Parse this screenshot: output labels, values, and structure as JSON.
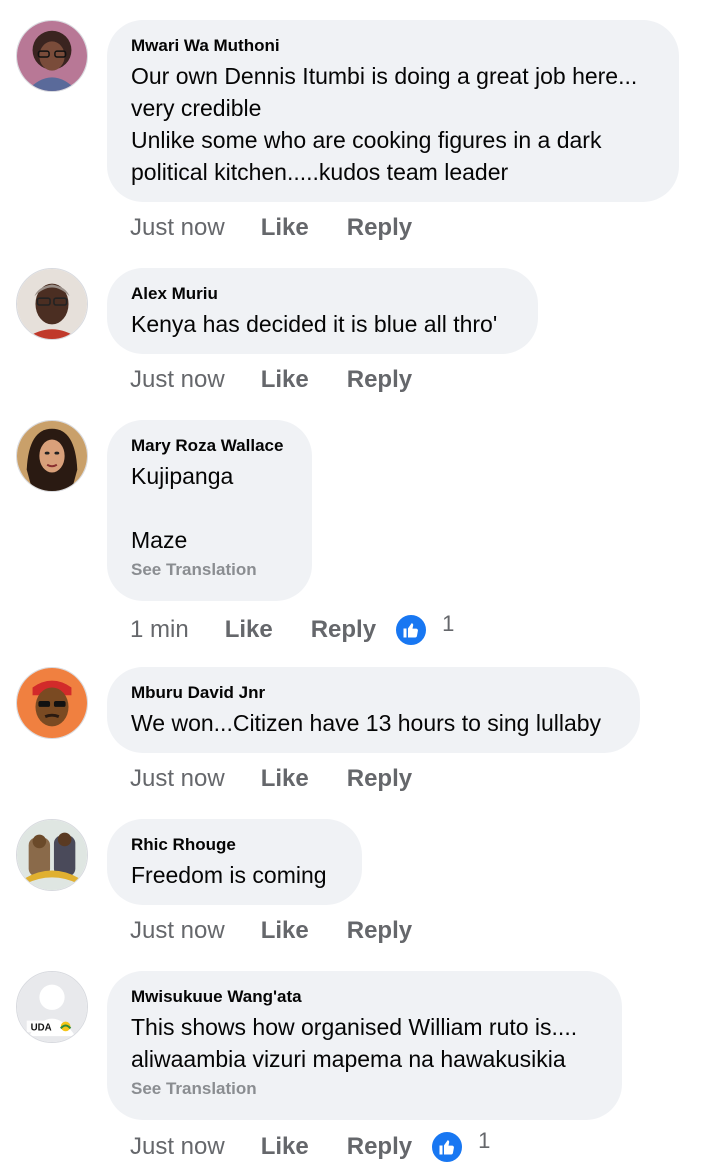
{
  "comments": [
    {
      "author": "Mwari Wa Muthoni",
      "text": "Our own Dennis Itumbi is doing a great job here...\nvery credible\nUnlike some who are cooking figures in a dark\npolitical kitchen.....kudos team leader",
      "time": "Just now",
      "like": "Like",
      "reply": "Reply"
    },
    {
      "author": "Alex Muriu",
      "text": "Kenya has decided it is blue all thro'",
      "time": "Just now",
      "like": "Like",
      "reply": "Reply"
    },
    {
      "author": "Mary Roza Wallace",
      "text": "Kujipanga\n\nMaze",
      "see_translation": "See Translation",
      "time": "1 min",
      "like": "Like",
      "reply": "Reply",
      "reaction_count": "1"
    },
    {
      "author": "Mburu David Jnr",
      "text": "We won...Citizen have 13 hours to sing lullaby",
      "time": "Just now",
      "like": "Like",
      "reply": "Reply"
    },
    {
      "author": "Rhic Rhouge",
      "text": "Freedom is coming",
      "time": "Just now",
      "like": "Like",
      "reply": "Reply"
    },
    {
      "author": "Mwisukuue Wang'ata",
      "text": "This shows how organised William ruto is....\naliwaambia vizuri mapema na hawakusikia",
      "see_translation": "See Translation",
      "time": "Just now",
      "like": "Like",
      "reply": "Reply",
      "reaction_count": "1",
      "avatar_badge": "UDA"
    }
  ],
  "colors": {
    "bubble": "#f0f2f5",
    "meta": "#65676b",
    "muted": "#8a8d91",
    "like_blue": "#1877f2"
  }
}
